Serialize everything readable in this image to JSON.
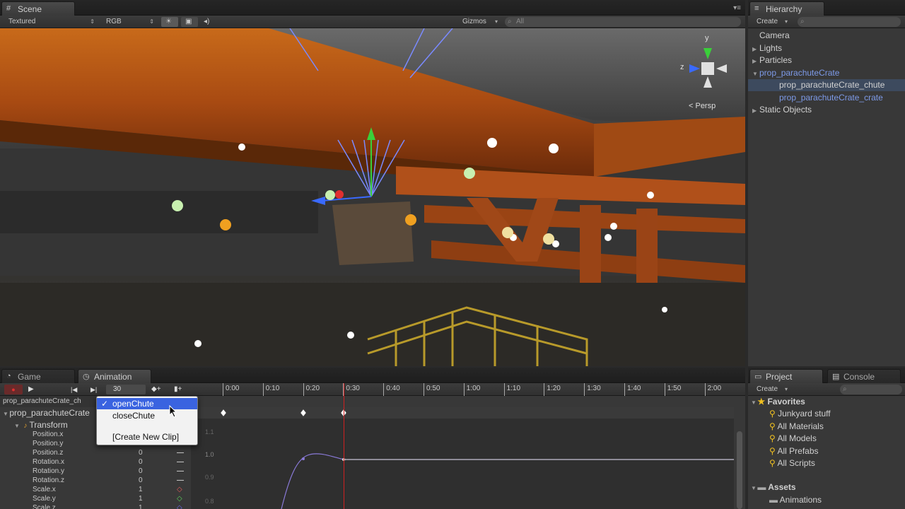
{
  "scene": {
    "tab_label": "Scene",
    "toolbar": {
      "render_mode": "Textured",
      "color_mode": "RGB",
      "gizmos_label": "Gizmos",
      "search_placeholder": "All"
    },
    "gizmo": {
      "y_label": "y",
      "z_label": "z",
      "persp_label": "< Persp"
    }
  },
  "hierarchy": {
    "tab_label": "Hierarchy",
    "create_label": "Create",
    "items": [
      {
        "label": "Camera",
        "indent": 0,
        "arrow": false,
        "blue": false,
        "selected": false
      },
      {
        "label": "Lights",
        "indent": 0,
        "arrow": true,
        "blue": false,
        "selected": false
      },
      {
        "label": "Particles",
        "indent": 0,
        "arrow": true,
        "blue": false,
        "selected": false
      },
      {
        "label": "prop_parachuteCrate",
        "indent": 0,
        "arrow": true,
        "blue": true,
        "selected": false
      },
      {
        "label": "prop_parachuteCrate_chute",
        "indent": 1,
        "arrow": false,
        "blue": false,
        "selected": true
      },
      {
        "label": "prop_parachuteCrate_crate",
        "indent": 1,
        "arrow": false,
        "blue": true,
        "selected": false
      },
      {
        "label": "Static Objects",
        "indent": 0,
        "arrow": true,
        "blue": false,
        "selected": false
      }
    ]
  },
  "animation": {
    "game_tab_label": "Game",
    "tab_label": "Animation",
    "frame_value": "30",
    "object_name": "prop_parachuteCrate_ch",
    "root_label": "prop_parachuteCrate",
    "transform_label": "Transform",
    "timeline_ticks": [
      "0:00",
      "0:10",
      "0:20",
      "0:30",
      "0:40",
      "0:50",
      "1:00",
      "1:10",
      "1:20",
      "1:30",
      "1:40",
      "1:50",
      "2:00"
    ],
    "properties": [
      {
        "name": "Position.x",
        "value": "",
        "key_color": "#cccccc"
      },
      {
        "name": "Position.y",
        "value": "",
        "key_color": "#cccccc"
      },
      {
        "name": "Position.z",
        "value": "0",
        "key_color": "#ffffff"
      },
      {
        "name": "Rotation.x",
        "value": "0",
        "key_color": "#ffffff"
      },
      {
        "name": "Rotation.y",
        "value": "0",
        "key_color": "#ffffff"
      },
      {
        "name": "Rotation.z",
        "value": "0",
        "key_color": "#ffffff"
      },
      {
        "name": "Scale.x",
        "value": "1",
        "key_color": "#e05a5a"
      },
      {
        "name": "Scale.y",
        "value": "1",
        "key_color": "#5ad05a"
      },
      {
        "name": "Scale.z",
        "value": "1",
        "key_color": "#6a6af0"
      }
    ],
    "curve_labels": [
      "1.1",
      "1.0",
      "0.9",
      "0.8"
    ]
  },
  "clip_menu": {
    "items": [
      {
        "label": "openChute",
        "selected": true
      },
      {
        "label": "closeChute",
        "selected": false
      },
      {
        "label": "[Create New Clip]",
        "selected": false
      }
    ]
  },
  "project": {
    "tab_label": "Project",
    "console_tab_label": "Console",
    "create_label": "Create",
    "favorites_label": "Favorites",
    "favorites": [
      "Junkyard stuff",
      "All Materials",
      "All Models",
      "All Prefabs",
      "All Scripts"
    ],
    "assets_label": "Assets",
    "assets": [
      "Animations"
    ]
  },
  "colors": {
    "selection_blue": "#3a63e0",
    "prefab_blue": "#7d9ae8",
    "playhead_red": "#d02020"
  }
}
